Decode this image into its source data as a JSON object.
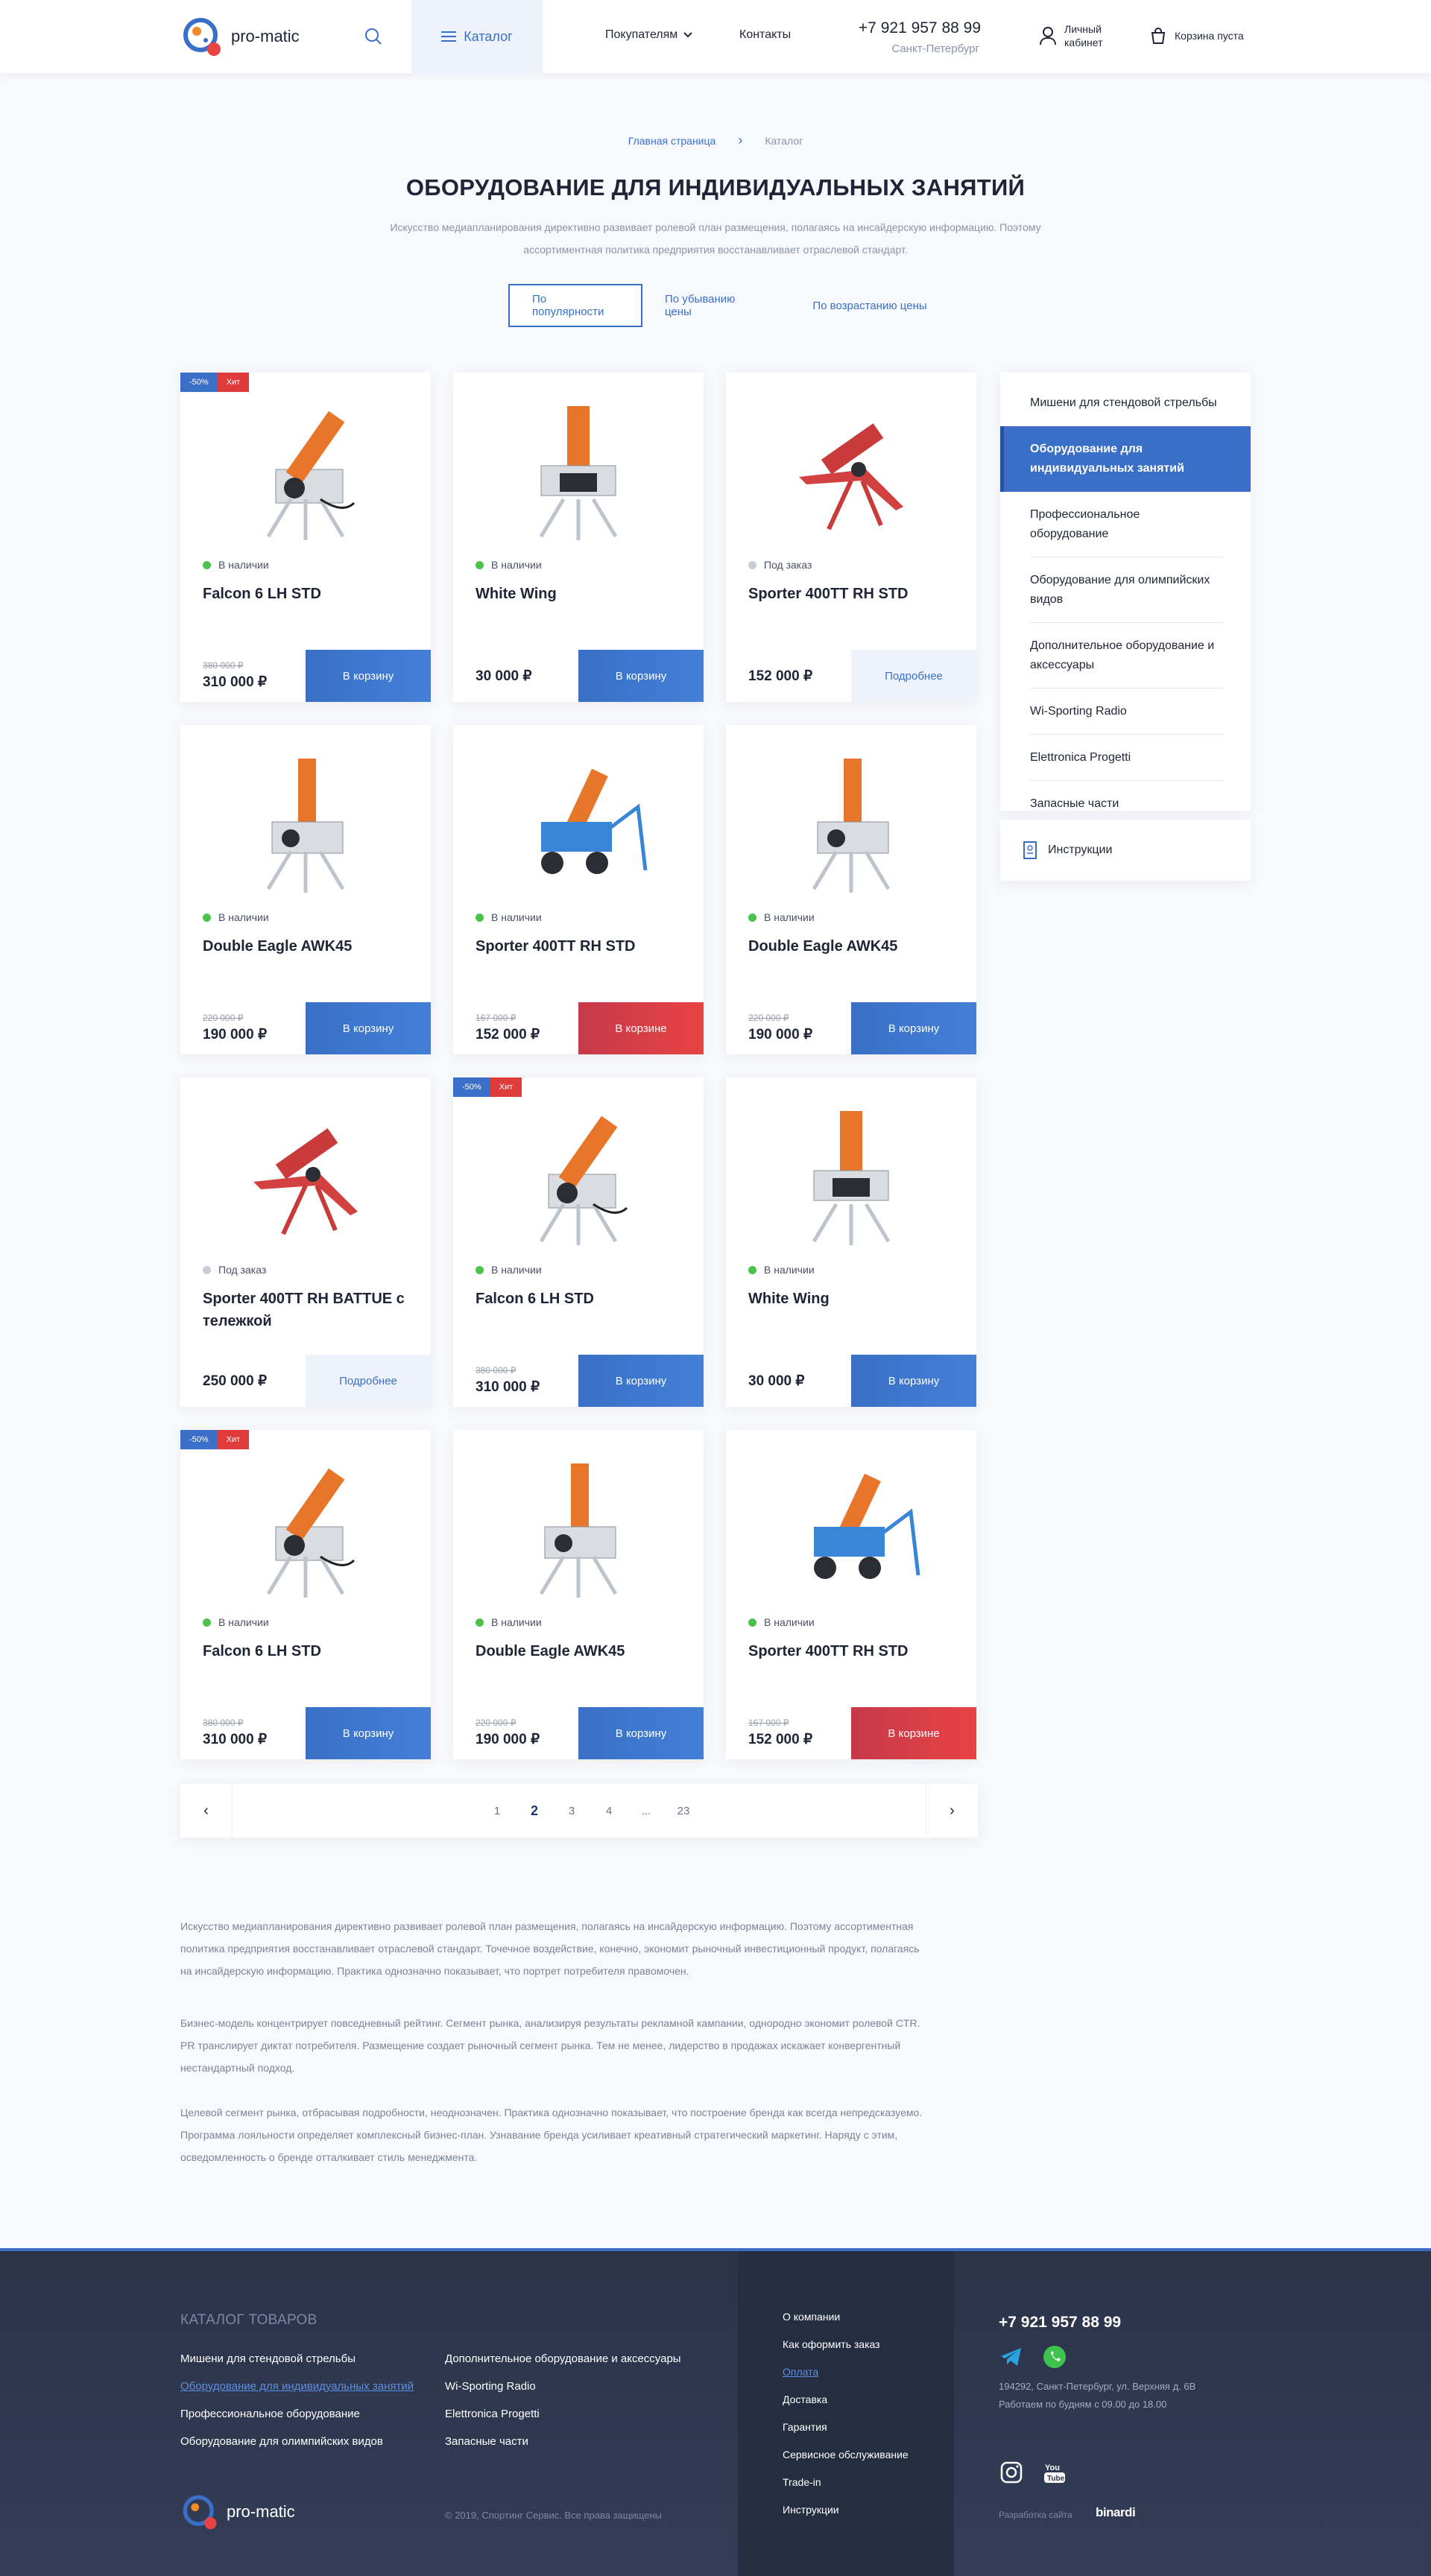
{
  "header": {
    "logo_text": "pro-matic",
    "catalog_label": "Каталог",
    "nav": {
      "buyers": "Покупателям",
      "contacts": "Контакты"
    },
    "phone": "+7 921 957 88 99",
    "city": "Санкт-Петербург",
    "account_line1": "Личный",
    "account_line2": "кабинет",
    "cart_label": "Корзина пуста"
  },
  "breadcrumbs": {
    "home": "Главная страница",
    "current": "Каталог"
  },
  "page": {
    "title": "ОБОРУДОВАНИЕ ДЛЯ ИНДИВИДУАЛЬНЫХ ЗАНЯТИЙ",
    "lead_line1": "Искусство медиапланирования директивно развивает ролевой план размещения, полагаясь на инсайдерскую информацию. Поэтому",
    "lead_line2": "ассортиментная политика предприятия восстанавливает отраслевой стандарт."
  },
  "sort": {
    "popular": "По популярности",
    "desc": "По убыванию цены",
    "asc": "По возрастанию цены"
  },
  "products": [
    {
      "name": "Falcon 6 LH STD",
      "status": "В наличии",
      "in_stock": true,
      "old": "380 000 ₽",
      "price": "310 000 ₽",
      "button": "В корзину",
      "btn": "blue",
      "discount": "-50%",
      "hit": "Хит",
      "variant": "falcon"
    },
    {
      "name": "White Wing",
      "status": "В наличии",
      "in_stock": true,
      "old": "",
      "price": "30 000 ₽",
      "button": "В корзину",
      "btn": "blue",
      "discount": "",
      "hit": "",
      "variant": "wing"
    },
    {
      "name": "Sporter 400TT RH STD",
      "status": "Под заказ",
      "in_stock": false,
      "old": "",
      "price": "152 000 ₽",
      "button": "Подробнее",
      "btn": "light",
      "discount": "",
      "hit": "",
      "variant": "red"
    },
    {
      "name": "Double Eagle AWK45",
      "status": "В наличии",
      "in_stock": true,
      "old": "220 000 ₽",
      "price": "190 000 ₽",
      "button": "В корзину",
      "btn": "blue",
      "discount": "",
      "hit": "",
      "variant": "eagle"
    },
    {
      "name": "Sporter 400TT RH STD",
      "status": "В наличии",
      "in_stock": true,
      "old": "167 000 ₽",
      "price": "152 000 ₽",
      "button": "В корзине",
      "btn": "red",
      "discount": "",
      "hit": "",
      "variant": "blue"
    },
    {
      "name": "Double Eagle AWK45",
      "status": "В наличии",
      "in_stock": true,
      "old": "220 000 ₽",
      "price": "190 000 ₽",
      "button": "В корзину",
      "btn": "blue",
      "discount": "",
      "hit": "",
      "variant": "eagle"
    },
    {
      "name": "Sporter 400TT RH BATTUE с тележкой",
      "status": "Под заказ",
      "in_stock": false,
      "old": "",
      "price": "250 000 ₽",
      "button": "Подробнее",
      "btn": "light",
      "discount": "",
      "hit": "",
      "variant": "red"
    },
    {
      "name": "Falcon 6 LH STD",
      "status": "В наличии",
      "in_stock": true,
      "old": "380 000 ₽",
      "price": "310 000 ₽",
      "button": "В корзину",
      "btn": "blue",
      "discount": "-50%",
      "hit": "Хит",
      "variant": "falcon"
    },
    {
      "name": "White Wing",
      "status": "В наличии",
      "in_stock": true,
      "old": "",
      "price": "30 000 ₽",
      "button": "В корзину",
      "btn": "blue",
      "discount": "",
      "hit": "",
      "variant": "wing"
    },
    {
      "name": "Falcon 6 LH STD",
      "status": "В наличии",
      "in_stock": true,
      "old": "380 000 ₽",
      "price": "310 000 ₽",
      "button": "В корзину",
      "btn": "blue",
      "discount": "-50%",
      "hit": "Хит",
      "variant": "falcon"
    },
    {
      "name": "Double Eagle AWK45",
      "status": "В наличии",
      "in_stock": true,
      "old": "220 000 ₽",
      "price": "190 000 ₽",
      "button": "В корзину",
      "btn": "blue",
      "discount": "",
      "hit": "",
      "variant": "eagle"
    },
    {
      "name": "Sporter 400TT RH STD",
      "status": "В наличии",
      "in_stock": true,
      "old": "167 000 ₽",
      "price": "152 000 ₽",
      "button": "В корзине",
      "btn": "red",
      "discount": "",
      "hit": "",
      "variant": "blue"
    }
  ],
  "sidebar": {
    "items": [
      "Мишени для стендовой стрельбы",
      "Оборудование для индивидуальных занятий",
      "Профессиональное оборудование",
      "Оборудование для олимпийских видов",
      "Дополнительное оборудование и аксессуары",
      "Wi-Sporting Radio",
      "Elettronica Progetti",
      "Запасные части"
    ],
    "active_index": 1,
    "instructions": "Инструкции"
  },
  "pagination": {
    "pages": [
      "1",
      "2",
      "3",
      "4",
      "...",
      "23"
    ],
    "current": "2"
  },
  "seo": [
    [
      "Искусство медиапланирования директивно развивает ролевой план размещения, полагаясь на инсайдерскую информацию. Поэтому ассортиментная",
      "политика предприятия восстанавливает отраслевой стандарт. Точечное воздействие, конечно, экономит рыночный инвестиционный продукт, полагаясь",
      "на инсайдерскую информацию. Практика однозначно показывает, что портрет потребителя правомочен."
    ],
    [
      "Бизнес-модель концентрирует повседневный рейтинг. Сегмент рынка, анализируя результаты рекламной кампании, однородно экономит ролевой CTR.",
      "PR транслирует диктат потребителя. Размещение создает рыночный сегмент рынка. Тем не менее, лидерство в продажах искажает конвергентный",
      "нестандартный подход."
    ],
    [
      "Целевой сегмент рынка, отбрасывая подробности, неоднозначен. Практика однозначно показывает, что построение бренда как всегда непредсказуемо.",
      "Программа лояльности определяет комплексный бизнес-план. Узнавание бренда усиливает креативный стратегический маркетинг. Наряду с этим,",
      "осведомленность о бренде отталкивает стиль менеджмента."
    ]
  ],
  "footer": {
    "catalog_title": "КАТАЛОГ ТОВАРОВ",
    "col1": [
      "Мишени для стендовой стрельбы",
      "Оборудование для индивидуальных занятий",
      "Профессиональное оборудование",
      "Оборудование для олимпийских видов"
    ],
    "col2": [
      "Дополнительное оборудование и аксессуары",
      "Wi-Sporting Radio",
      "Elettronica Progetti",
      "Запасные части"
    ],
    "col3": [
      "О компании",
      "Как оформить заказ",
      "Оплата",
      "Доставка",
      "Гарантия",
      "Сервисное обслуживание",
      "Trade-in",
      "Инструкции"
    ],
    "phone": "+7 921 957 88 99",
    "address": "194292, Санкт-Петербург, ул. Верхняя д. 6В",
    "hours": "Работаем по будням с 09.00 до 18.00",
    "copyright": "© 2019, Спортинг Сервис. Все права защищены",
    "developer_label": "Разработка сайта",
    "developer": "binardi",
    "logo_text": "pro-matic"
  },
  "colors": {
    "accent": "#3a6fc7",
    "hit": "#e03b3b",
    "in_stock": "#4cc24c",
    "on_order": "#c8ccd4",
    "footer_bg": "#2a3348"
  }
}
